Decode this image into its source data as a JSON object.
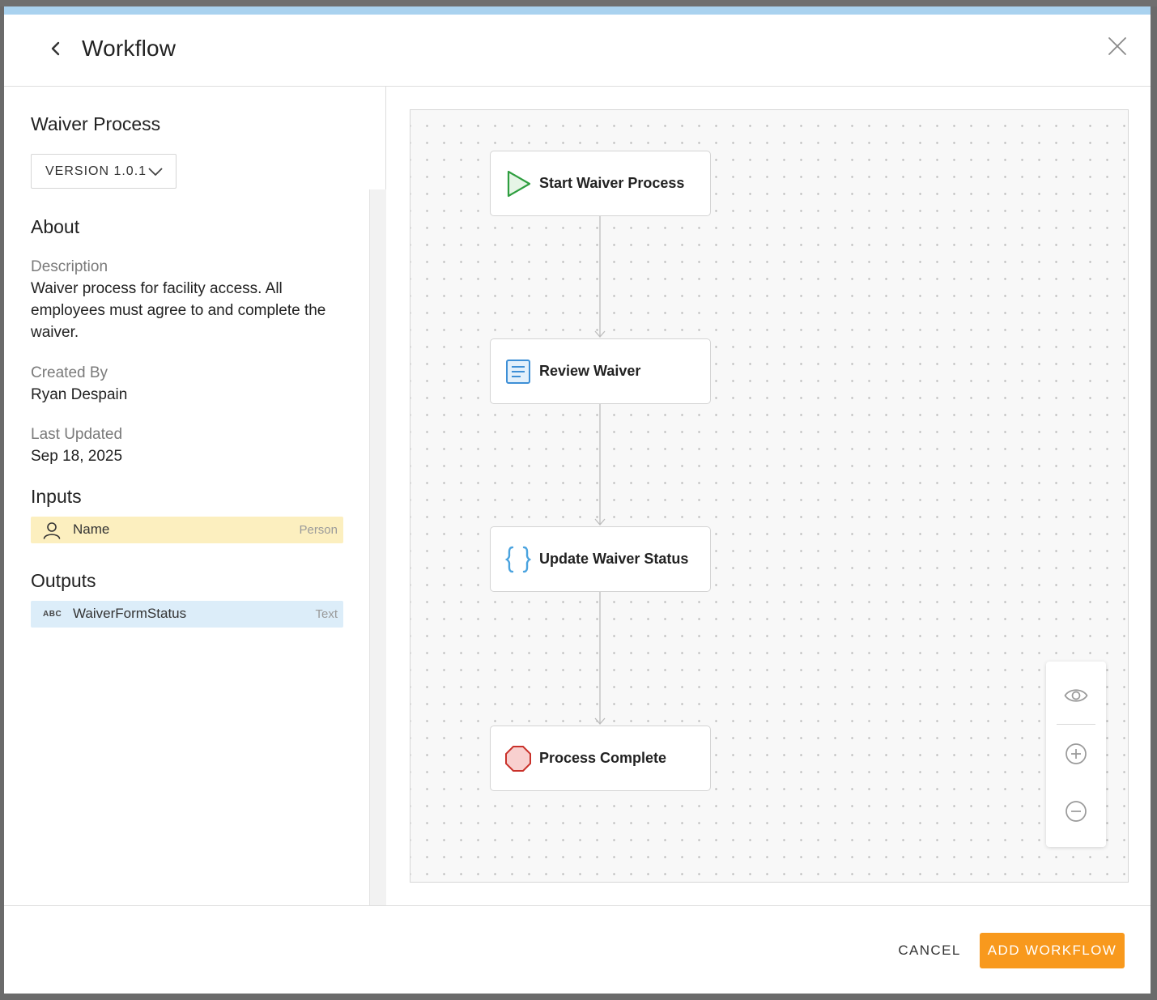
{
  "modal": {
    "title": "Workflow",
    "back_icon": "chevron-left-icon",
    "close_icon": "close-icon"
  },
  "workflow": {
    "name": "Waiver Process",
    "version": "VERSION 1.0.1",
    "about_heading": "About",
    "description_label": "Description",
    "description": "Waiver process for facility access. All employees must agree to and complete the waiver.",
    "created_by_label": "Created By",
    "created_by": "Ryan Despain",
    "last_updated_label": "Last Updated",
    "last_updated": "Sep 18, 2025",
    "inputs_heading": "Inputs",
    "inputs": [
      {
        "name": "Name",
        "type": "Person",
        "icon": "person-icon"
      }
    ],
    "outputs_heading": "Outputs",
    "outputs": [
      {
        "name": "WaiverFormStatus",
        "type": "Text",
        "icon_text": "ABC"
      }
    ]
  },
  "diagram": {
    "nodes": [
      {
        "label": "Start Waiver Process",
        "icon": "play-icon"
      },
      {
        "label": "Review Waiver",
        "icon": "document-icon"
      },
      {
        "label": "Update Waiver Status",
        "icon": "braces-icon"
      },
      {
        "label": "Process Complete",
        "icon": "stop-icon"
      }
    ],
    "controls": [
      "eye-icon",
      "zoom-in-icon",
      "zoom-out-icon"
    ]
  },
  "footer": {
    "cancel_label": "CANCEL",
    "add_label": "ADD WORKFLOW"
  },
  "colors": {
    "accent": "#f8991d",
    "top_bar": "#a9d2ef",
    "input_bg": "#fcefbf",
    "output_bg": "#dcedf9",
    "start_green": "#2e9e3f",
    "doc_blue": "#3d8fd6",
    "stop_red": "#c9312a"
  }
}
